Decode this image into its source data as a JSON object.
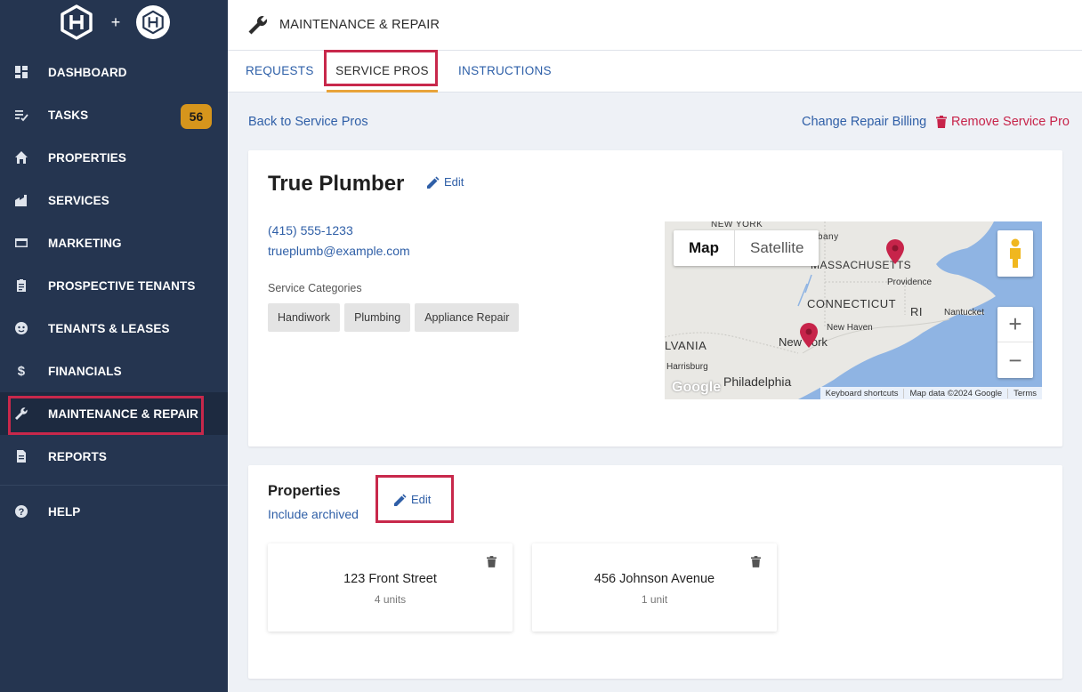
{
  "sidebar": {
    "logo_plus": "+",
    "items": [
      {
        "label": "DASHBOARD",
        "icon": "dashboard-icon"
      },
      {
        "label": "TASKS",
        "icon": "tasks-icon",
        "badge": "56"
      },
      {
        "label": "PROPERTIES",
        "icon": "home-icon"
      },
      {
        "label": "SERVICES",
        "icon": "services-icon"
      },
      {
        "label": "MARKETING",
        "icon": "marketing-icon"
      },
      {
        "label": "PROSPECTIVE TENANTS",
        "icon": "clipboard-icon"
      },
      {
        "label": "TENANTS & LEASES",
        "icon": "tenant-icon"
      },
      {
        "label": "FINANCIALS",
        "icon": "dollar-icon"
      },
      {
        "label": "MAINTENANCE & REPAIR",
        "icon": "wrench-icon",
        "active": true
      },
      {
        "label": "REPORTS",
        "icon": "report-icon"
      }
    ],
    "help": {
      "label": "HELP",
      "icon": "help-icon"
    }
  },
  "header": {
    "title": "MAINTENANCE & REPAIR",
    "icon": "wrench-icon"
  },
  "tabs": [
    {
      "label": "REQUESTS"
    },
    {
      "label": "SERVICE PROS",
      "active": true
    },
    {
      "label": "INSTRUCTIONS"
    }
  ],
  "actions": {
    "back": "Back to Service Pros",
    "change_billing": "Change Repair Billing",
    "remove": "Remove Service Pro"
  },
  "pro": {
    "name": "True Plumber",
    "edit_label": "Edit",
    "phone": "(415) 555-1233",
    "email": "trueplumb@example.com",
    "categories_label": "Service Categories",
    "categories": [
      "Handiwork",
      "Plumbing",
      "Appliance Repair"
    ]
  },
  "map": {
    "type_map": "Map",
    "type_satellite": "Satellite",
    "zoom_in": "+",
    "zoom_out": "−",
    "labels": {
      "ny_state": "NEW YORK",
      "albany": "Albany",
      "massachusetts": "MASSACHUSETTS",
      "providence": "Providence",
      "connecticut": "CONNECTICUT",
      "ri": "RI",
      "nantucket": "Nantucket",
      "new_haven": "New Haven",
      "new_york": "New York",
      "pennsylvania": "LVANIA",
      "harrisburg": "Harrisburg",
      "philadelphia": "Philadelphia"
    },
    "google": "Google",
    "footer": [
      "Keyboard shortcuts",
      "Map data ©2024 Google",
      "Terms"
    ],
    "water_color": "#8fb4e3",
    "pin_color": "#c7244a"
  },
  "properties": {
    "title": "Properties",
    "edit_label": "Edit",
    "include_archived": "Include archived",
    "items": [
      {
        "name": "123 Front Street",
        "units": "4 units"
      },
      {
        "name": "456 Johnson Avenue",
        "units": "1 unit"
      }
    ]
  },
  "colors": {
    "sidebar": "#253550",
    "accent": "#e8a33a",
    "link": "#2f5fa7",
    "danger": "#c7244a",
    "highlight": "#c8284b"
  }
}
